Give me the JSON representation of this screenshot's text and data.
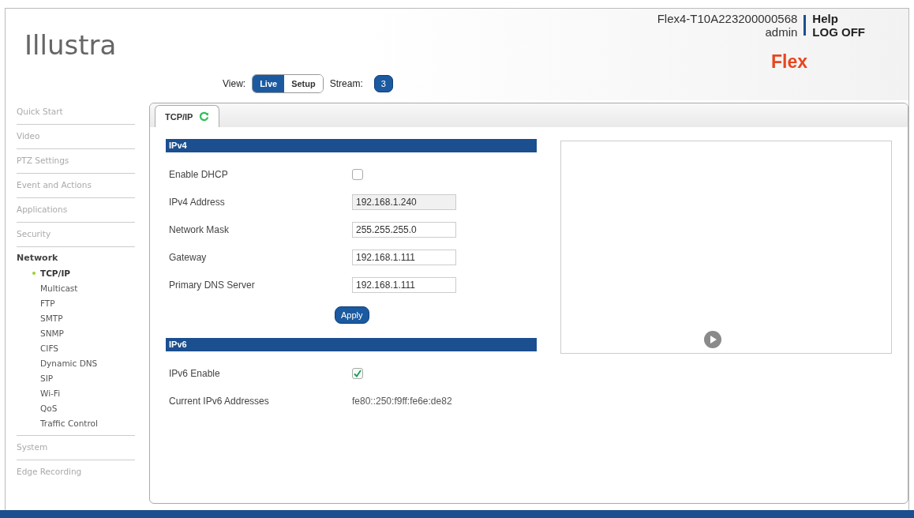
{
  "header": {
    "logo": "Illustra",
    "device_name": "Flex4-T10A223200000568",
    "user": "admin",
    "links": [
      "Help",
      "LOG OFF"
    ],
    "product": "Flex"
  },
  "view": {
    "label": "View:",
    "options": [
      {
        "label": "Live",
        "selected": true
      },
      {
        "label": "Setup",
        "selected": false
      }
    ],
    "stream_label": "Stream:",
    "stream": "3"
  },
  "sidebar": {
    "items": [
      {
        "label": "Quick Start",
        "expanded": false
      },
      {
        "label": "Video",
        "expanded": false
      },
      {
        "label": "PTZ Settings",
        "expanded": false
      },
      {
        "label": "Event and Actions",
        "expanded": false
      },
      {
        "label": "Applications",
        "expanded": false
      },
      {
        "label": "Security",
        "expanded": false
      },
      {
        "label": "Network",
        "expanded": true,
        "children": [
          {
            "label": "TCP/IP",
            "selected": true
          },
          {
            "label": "Multicast",
            "selected": false
          },
          {
            "label": "FTP",
            "selected": false
          },
          {
            "label": "SMTP",
            "selected": false
          },
          {
            "label": "SNMP",
            "selected": false
          },
          {
            "label": "CIFS",
            "selected": false
          },
          {
            "label": "Dynamic DNS",
            "selected": false
          },
          {
            "label": "SIP",
            "selected": false
          },
          {
            "label": "Wi-Fi",
            "selected": false
          },
          {
            "label": "QoS",
            "selected": false
          },
          {
            "label": "Traffic Control",
            "selected": false
          }
        ]
      },
      {
        "label": "System",
        "expanded": false
      },
      {
        "label": "Edge Recording",
        "expanded": false
      }
    ]
  },
  "tabs": [
    {
      "label": "TCP/IP",
      "selected": true
    }
  ],
  "sections": [
    {
      "title": "IPv4",
      "rows": [
        {
          "kind": "checkbox",
          "label": "Enable DHCP",
          "checked": false
        },
        {
          "kind": "input",
          "label": "IPv4 Address",
          "value": "192.168.1.240",
          "disabled": true
        },
        {
          "kind": "input",
          "label": "Network Mask",
          "value": "255.255.255.0",
          "disabled": false
        },
        {
          "kind": "input",
          "label": "Gateway",
          "value": "192.168.1.111",
          "disabled": false
        },
        {
          "kind": "input",
          "label": "Primary DNS Server",
          "value": "192.168.1.111",
          "disabled": false
        }
      ],
      "button": "Apply"
    },
    {
      "title": "IPv6",
      "rows": [
        {
          "kind": "checkbox",
          "label": "IPv6 Enable",
          "checked": true
        },
        {
          "kind": "text",
          "label": "Current IPv6 Addresses",
          "value": "fe80::250:f9ff:fe6e:de82"
        }
      ]
    }
  ]
}
